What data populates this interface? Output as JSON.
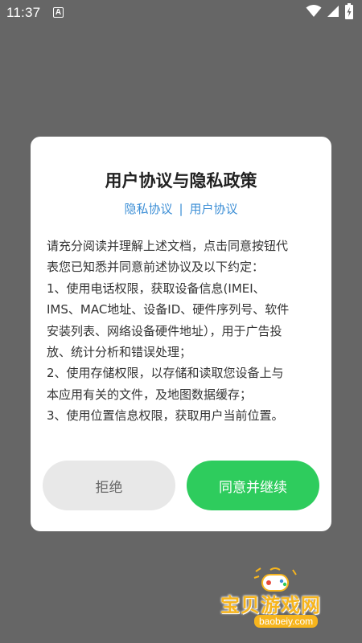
{
  "status_bar": {
    "time": "11:37",
    "notification_letter": "A",
    "icons": [
      "wifi-icon",
      "signal-icon",
      "battery-charging-icon"
    ]
  },
  "dialog": {
    "title": "用户协议与隐私政策",
    "links": {
      "privacy_label": "隐私协议",
      "separator": "|",
      "user_label": "用户协议"
    },
    "body_lines": [
      "请充分阅读并理解上述文档，点击同意按钮代",
      "表您已知悉并同意前述协议及以下约定：",
      "1、使用电话权限，获取设备信息(IMEI、",
      "IMS、MAC地址、设备ID、硬件序列号、软件",
      "安装列表、网络设备硬件地址），用于广告投",
      "放、统计分析和错误处理；",
      "2、使用存储权限，以存储和读取您设备上与",
      "本应用有关的文件，及地图数据缓存；",
      "3、使用位置信息权限，获取用户当前位置。"
    ],
    "reject_label": "拒绝",
    "agree_label": "同意并继续"
  },
  "watermark": {
    "title": "宝贝游戏网",
    "url": "baobeiy.com"
  },
  "colors": {
    "backdrop": "#666666",
    "link": "#3d8fd6",
    "agree_button": "#2ecc5d",
    "reject_button": "#e8e8e8",
    "watermark": "#f7b51d"
  }
}
